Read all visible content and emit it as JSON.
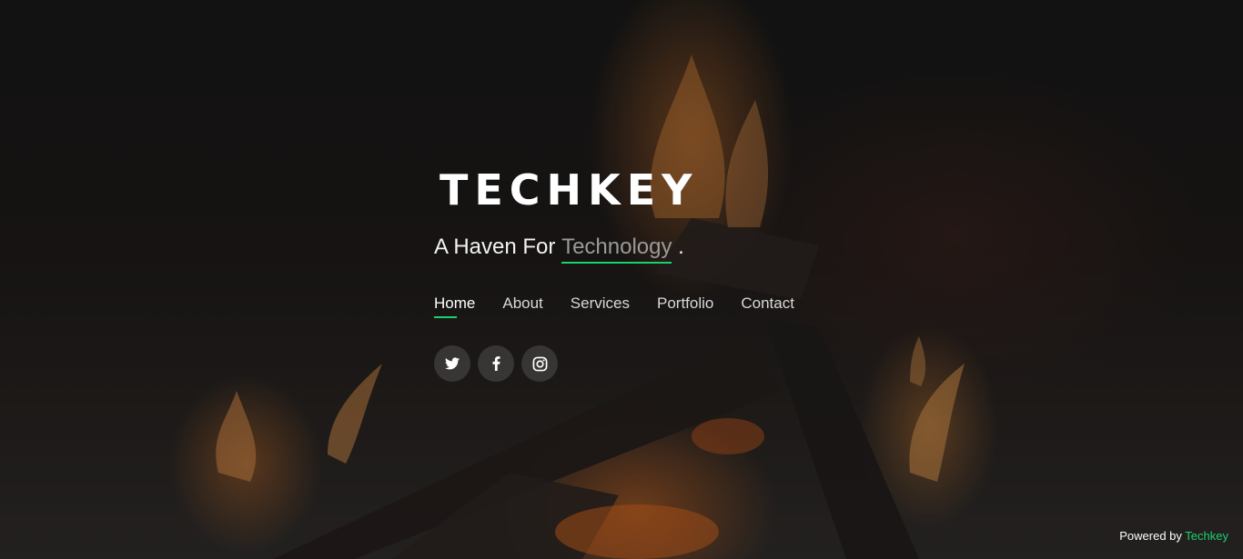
{
  "hero": {
    "brand": "TECHKEY",
    "tagline_prefix": "A Haven For ",
    "tagline_typed": "Technology",
    "tagline_suffix": " ."
  },
  "nav": {
    "items": [
      {
        "label": "Home",
        "active": true
      },
      {
        "label": "About",
        "active": false
      },
      {
        "label": "Services",
        "active": false
      },
      {
        "label": "Portfolio",
        "active": false
      },
      {
        "label": "Contact",
        "active": false
      }
    ]
  },
  "socials": [
    {
      "icon": "twitter-icon"
    },
    {
      "icon": "facebook-icon"
    },
    {
      "icon": "instagram-icon"
    }
  ],
  "footer": {
    "powered_by": "Powered by ",
    "credit": "Techkey"
  },
  "colors": {
    "accent": "#18d26e",
    "background": "#141414",
    "text": "#ffffff"
  }
}
